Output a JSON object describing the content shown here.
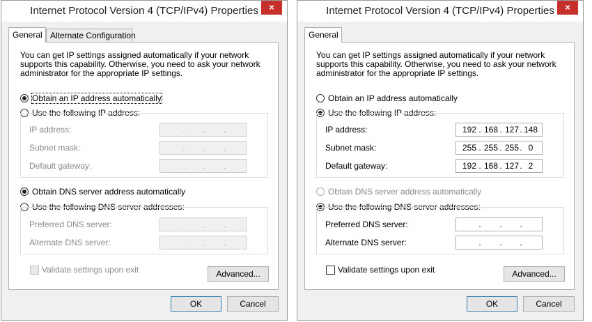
{
  "dialogs": [
    {
      "title": "Internet Protocol Version 4 (TCP/IPv4) Properties",
      "close_icon": "×",
      "tabs": [
        "General",
        "Alternate Configuration"
      ],
      "intro": "You can get IP settings assigned automatically if your network supports this capability. Otherwise, you need to ask your network administrator for the appropriate IP settings.",
      "ip_auto_label": "Obtain an IP address automatically",
      "ip_manual_label": "Use the following IP address:",
      "ip_auto_selected": true,
      "ip_fields": [
        {
          "label": "IP address:",
          "octets": [
            "",
            "",
            "",
            ""
          ]
        },
        {
          "label": "Subnet mask:",
          "octets": [
            "",
            "",
            "",
            ""
          ]
        },
        {
          "label": "Default gateway:",
          "octets": [
            "",
            "",
            "",
            ""
          ]
        }
      ],
      "dns_auto_label": "Obtain DNS server address automatically",
      "dns_manual_label": "Use the following DNS server addresses:",
      "dns_auto_selected": true,
      "dns_fields": [
        {
          "label": "Preferred DNS server:",
          "octets": [
            "",
            "",
            "",
            ""
          ]
        },
        {
          "label": "Alternate DNS server:",
          "octets": [
            "",
            "",
            "",
            ""
          ]
        }
      ],
      "validate_label": "Validate settings upon exit",
      "validate_checked": false,
      "advanced_label": "Advanced...",
      "ok_label": "OK",
      "cancel_label": "Cancel"
    },
    {
      "title": "Internet Protocol Version 4 (TCP/IPv4) Properties",
      "close_icon": "×",
      "tabs": [
        "General"
      ],
      "intro": "You can get IP settings assigned automatically if your network supports this capability. Otherwise, you need to ask your network administrator for the appropriate IP settings.",
      "ip_auto_label": "Obtain an IP address automatically",
      "ip_manual_label": "Use the following IP address:",
      "ip_auto_selected": false,
      "ip_fields": [
        {
          "label": "IP address:",
          "octets": [
            "192",
            "168",
            "127",
            "148"
          ]
        },
        {
          "label": "Subnet mask:",
          "octets": [
            "255",
            "255",
            "255",
            "0"
          ]
        },
        {
          "label": "Default gateway:",
          "octets": [
            "192",
            "168",
            "127",
            "2"
          ]
        }
      ],
      "dns_auto_label": "Obtain DNS server address automatically",
      "dns_manual_label": "Use the following DNS server addresses:",
      "dns_auto_selected": false,
      "dns_fields": [
        {
          "label": "Preferred DNS server:",
          "octets": [
            "",
            "",
            "",
            ""
          ]
        },
        {
          "label": "Alternate DNS server:",
          "octets": [
            "",
            "",
            "",
            ""
          ]
        }
      ],
      "validate_label": "Validate settings upon exit",
      "validate_checked": false,
      "advanced_label": "Advanced...",
      "ok_label": "OK",
      "cancel_label": "Cancel"
    }
  ]
}
